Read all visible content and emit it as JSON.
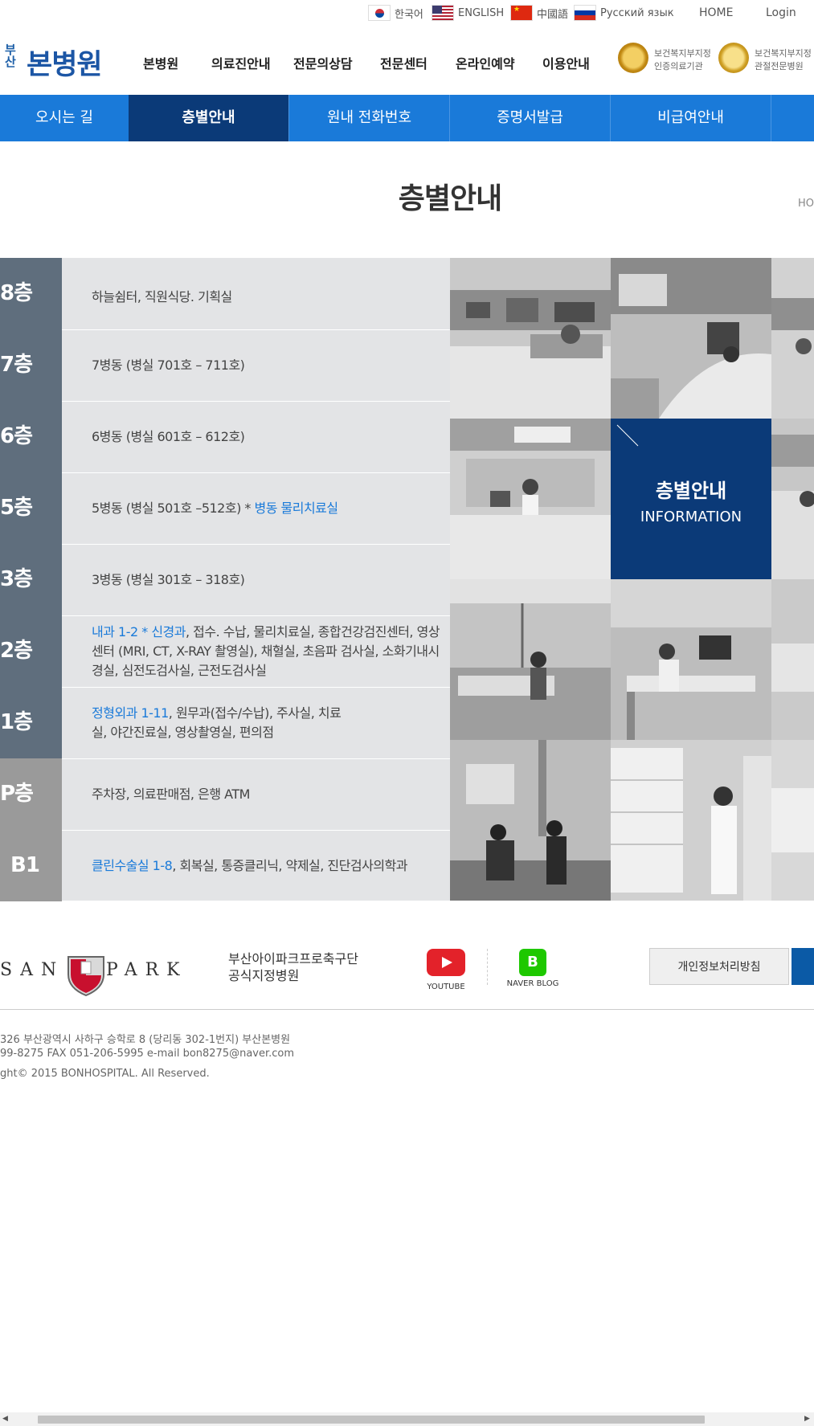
{
  "top_bar": {
    "languages": [
      {
        "label": "한국어",
        "flag": "kr"
      },
      {
        "label": "ENGLISH",
        "flag": "us"
      },
      {
        "label": "中國語",
        "flag": "cn"
      },
      {
        "label": "Русский язык",
        "flag": "ru"
      }
    ],
    "home": "HOME",
    "login": "Login"
  },
  "header": {
    "logo_small": "부산",
    "logo_main": "본병원",
    "gnb": [
      "본병원",
      "의료진안내",
      "전문의상담",
      "전문센터",
      "온라인예약",
      "이용안내"
    ],
    "badges": [
      {
        "line1": "보건복지부지정",
        "line2": "인증의료기관"
      },
      {
        "line1": "보건복지부지정",
        "line2": "관절전문병원"
      }
    ]
  },
  "subnav": {
    "items": [
      "오시는 길",
      "층별안내",
      "원내 전화번호",
      "증명서발급",
      "비급여안내"
    ],
    "active_index": 1
  },
  "page": {
    "title": "층별안내",
    "breadcrumb": "HO"
  },
  "floors": [
    {
      "floor": "8층",
      "parts": [
        {
          "text": "하늘쉼터, 직원식당. 기획실",
          "hl": false
        }
      ]
    },
    {
      "floor": "7층",
      "parts": [
        {
          "text": "7병동 (병실 701호 – 711호)",
          "hl": false
        }
      ]
    },
    {
      "floor": "6층",
      "parts": [
        {
          "text": "6병동 (병실 601호 – 612호)",
          "hl": false
        }
      ]
    },
    {
      "floor": "5층",
      "parts": [
        {
          "text": "5병동 (병실 501호 –512호) * ",
          "hl": false
        },
        {
          "text": "병동 물리치료실",
          "hl": true
        }
      ]
    },
    {
      "floor": "3층",
      "parts": [
        {
          "text": "3병동 (병실 301호 – 318호)",
          "hl": false
        }
      ]
    },
    {
      "floor": "2층",
      "parts": [
        {
          "text": "내과 1-2 * 신경과",
          "hl": true
        },
        {
          "text": ", 접수. 수납, 물리치료실, 종합건강검진센터, 영상센터 (MRI, CT, X-RAY  촬영실), 채혈실, 초음파 검사실, 소화기내시경실, 심전도검사실, 근전도검사실",
          "hl": false
        }
      ]
    },
    {
      "floor": "1층",
      "parts": [
        {
          "text": "정형외과 1-11",
          "hl": true
        },
        {
          "text": ", 원무과(접수/수납), 주사실, 치료실, 야간진료실, 영상촬영실, 편의점",
          "hl": false
        }
      ]
    },
    {
      "floor": "P층",
      "parts": [
        {
          "text": "주차장, 의료판매점, 은행 ATM",
          "hl": false
        }
      ]
    },
    {
      "floor": "B1",
      "parts": [
        {
          "text": "클린수술실 1-8",
          "hl": true
        },
        {
          "text": ", 회복실, 통증클리닉, 약제실, 진단검사의학과",
          "hl": false
        }
      ]
    }
  ],
  "info_box": {
    "title": "층별안내",
    "subtitle": "INFORMATION"
  },
  "footer": {
    "team_logo": "SAN   I'PARK",
    "team_text_line1": "부산아이파크프로축구단",
    "team_text_line2": "공식지정병원",
    "youtube_label": "YOUTUBE",
    "naver_label": "NAVER BLOG",
    "naver_icon": "B",
    "privacy_button": "개인정보처리방침",
    "address": "326 부산광역시 사하구 승학로 8 (당리동 302-1번지) 부산본병원",
    "contact": "99-8275 FAX 051-206-5995 e-mail bon8275@naver.com",
    "copyright": "ght© 2015 BONHOSPITAL. All Reserved."
  }
}
